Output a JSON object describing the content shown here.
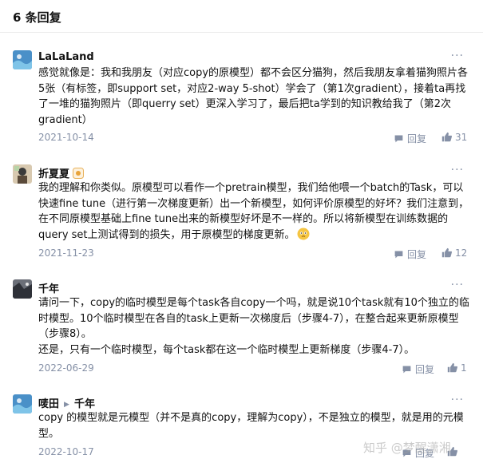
{
  "header": {
    "title": "6 条回复"
  },
  "comments": [
    {
      "author": "LaLaLand",
      "content": "感觉就像是：我和我朋友（对应copy的原模型）都不会区分猫狗，然后我朋友拿着猫狗照片各5张（有标签，即support set，对应2-way 5-shot）学会了（第1次gradient），接着ta再找了一堆的猫狗照片（即querry set）更深入学习了，最后把ta学到的知识教给我了（第2次gradient）",
      "date": "2021-10-14",
      "reply_label": "回复",
      "likes": "31"
    },
    {
      "author": "折夏夏",
      "content": "我的理解和你类似。原模型可以看作一个pretrain模型，我们给他喂一个batch的Task，可以快速fine tune（进行第一次梯度更新）出一个新模型，如何评价原模型的好坏？我们注意到，在不同原模型基础上fine tune出来的新模型好坏是不一样的。所以将新模型在训练数据的query set上测试得到的损失，用于原模型的梯度更新。",
      "date": "2021-11-23",
      "reply_label": "回复",
      "likes": "12"
    },
    {
      "author": "千年",
      "content": "请问一下，copy的临时模型是每个task各自copy一个吗，就是说10个task就有10个独立的临时模型。10个临时模型在各自的task上更新一次梯度后（步骤4-7），在整合起来更新原模型（步骤8）。",
      "content2": "还是，只有一个临时模型，每个task都在这一个临时模型上更新梯度（步骤4-7）。",
      "date": "2022-06-29",
      "reply_label": "回复",
      "likes": "1"
    },
    {
      "author": "唛田",
      "reply_to": "千年",
      "content": "copy 的模型就是元模型（并不是真的copy，理解为copy），不是独立的模型，就是用的元模型。",
      "date": "2022-10-17",
      "reply_label": "回复",
      "likes": ""
    }
  ],
  "more_label": "···",
  "watermark": "知乎 @梦醒潇湘",
  "colors": {
    "meta": "#8590a6",
    "text": "#121212",
    "divider": "#ebebeb"
  },
  "icons": {
    "reply": "reply-icon",
    "like": "thumb-up-icon",
    "more": "more-icon"
  }
}
